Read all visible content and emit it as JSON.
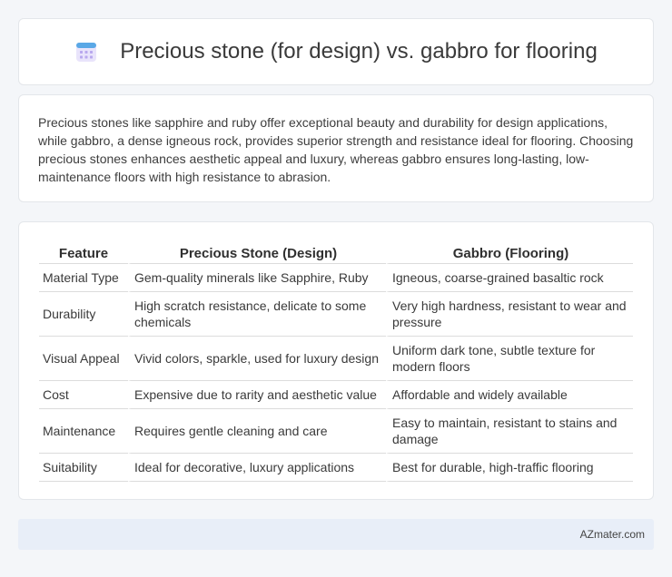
{
  "header": {
    "title": "Precious stone (for design) vs. gabbro for flooring",
    "icon": "calendar-grid-icon"
  },
  "intro": {
    "text": "Precious stones like sapphire and ruby offer exceptional beauty and durability for design applications, while gabbro, a dense igneous rock, provides superior strength and resistance ideal for flooring. Choosing precious stones enhances aesthetic appeal and luxury, whereas gabbro ensures long-lasting, low-maintenance floors with high resistance to abrasion."
  },
  "table": {
    "headers": [
      "Feature",
      "Precious Stone (Design)",
      "Gabbro (Flooring)"
    ],
    "rows": [
      [
        "Material Type",
        "Gem-quality minerals like Sapphire, Ruby",
        "Igneous, coarse-grained basaltic rock"
      ],
      [
        "Durability",
        "High scratch resistance, delicate to some chemicals",
        "Very high hardness, resistant to wear and pressure"
      ],
      [
        "Visual Appeal",
        "Vivid colors, sparkle, used for luxury design",
        "Uniform dark tone, subtle texture for modern floors"
      ],
      [
        "Cost",
        "Expensive due to rarity and aesthetic value",
        "Affordable and widely available"
      ],
      [
        "Maintenance",
        "Requires gentle cleaning and care",
        "Easy to maintain, resistant to stains and damage"
      ],
      [
        "Suitability",
        "Ideal for decorative, luxury applications",
        "Best for durable, high-traffic flooring"
      ]
    ]
  },
  "footer": {
    "brand": "AZmater.com"
  },
  "colors": {
    "background": "#f4f6f9",
    "footer_bg": "#e8eef8",
    "icon_purple": "#8b7fe0",
    "icon_blue": "#5aa8e6"
  }
}
